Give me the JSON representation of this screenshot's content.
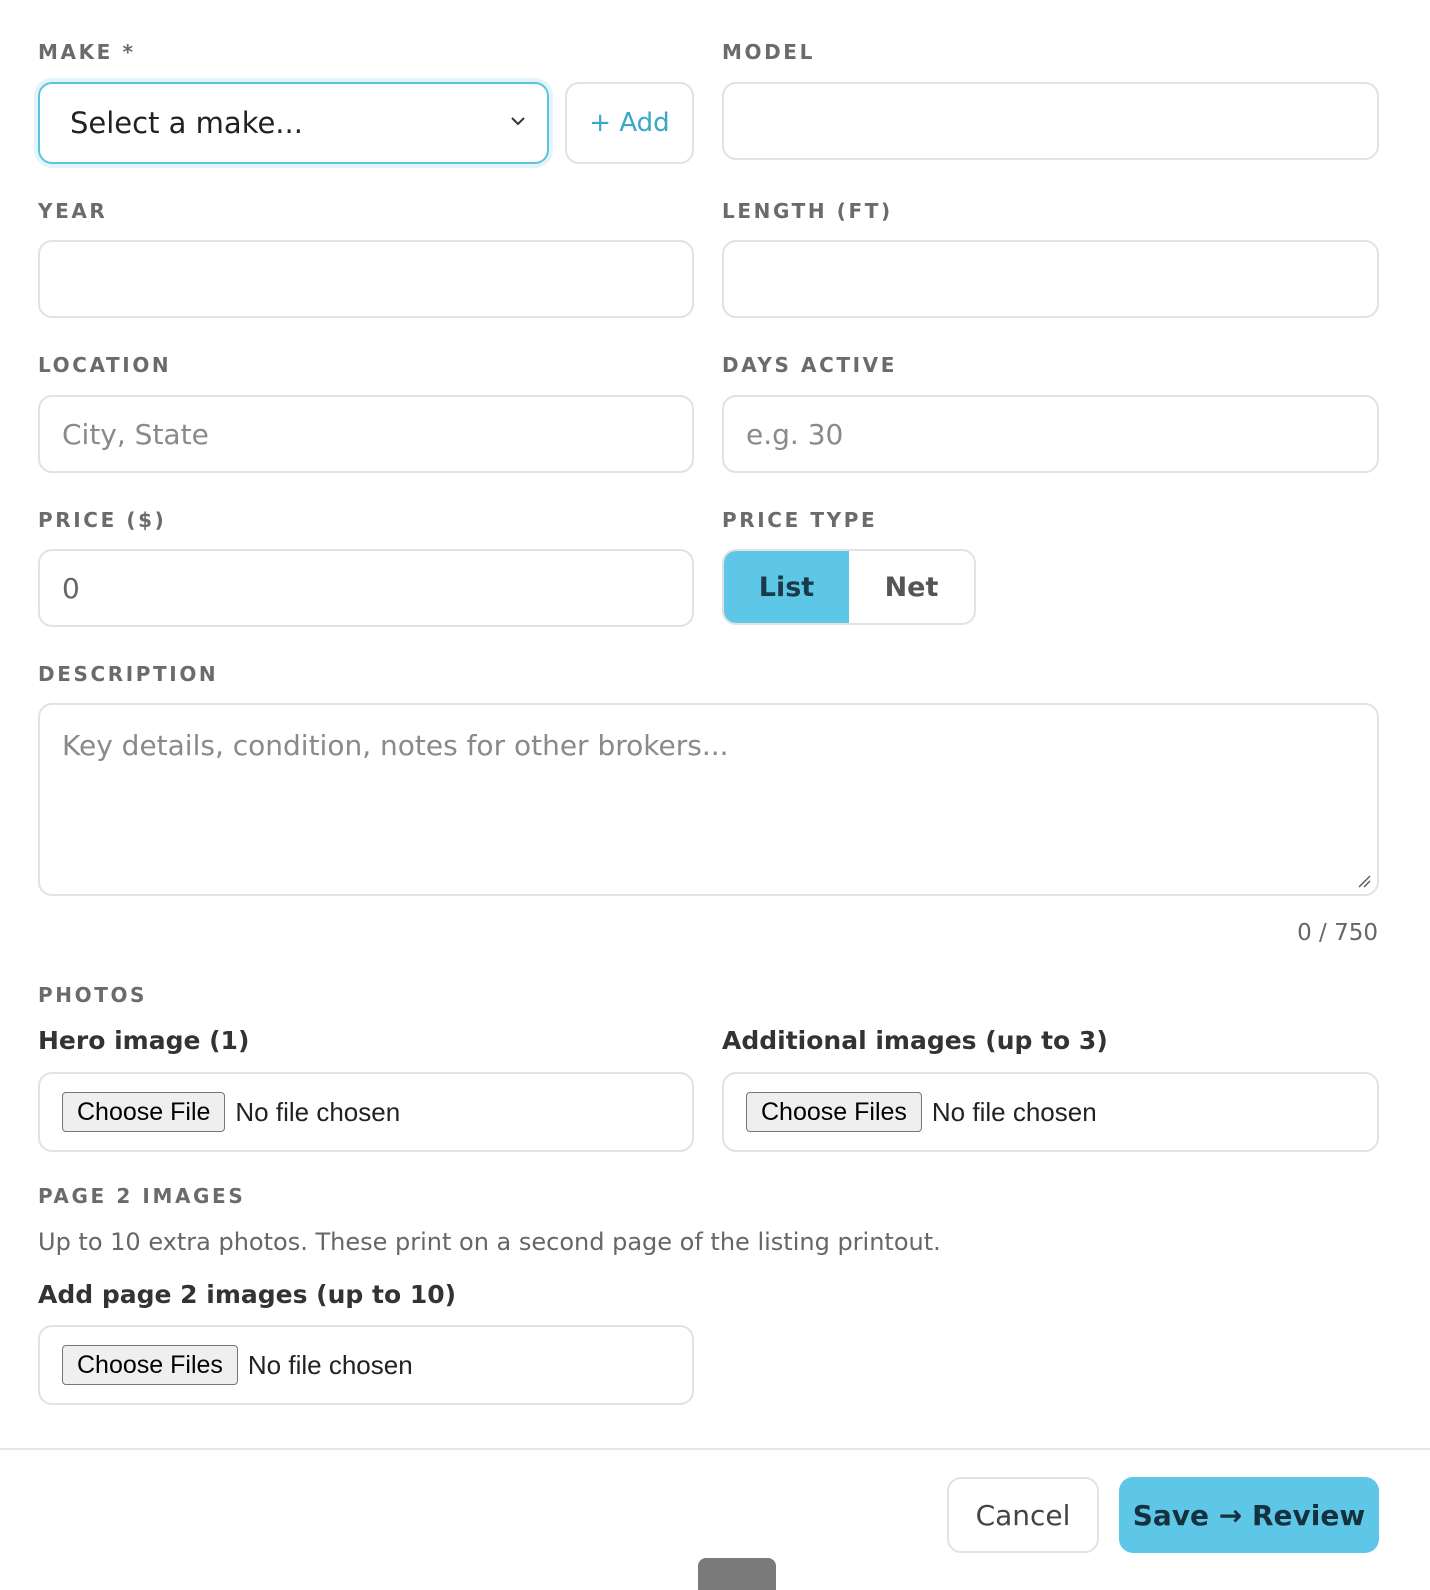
{
  "make": {
    "label": "MAKE *",
    "selected": "Select a make...",
    "add_label": "+ Add"
  },
  "model": {
    "label": "MODEL",
    "value": ""
  },
  "year": {
    "label": "YEAR",
    "value": ""
  },
  "length": {
    "label": "LENGTH (FT)",
    "value": ""
  },
  "location": {
    "label": "LOCATION",
    "placeholder": "City, State"
  },
  "days_active": {
    "label": "DAYS ACTIVE",
    "placeholder": "e.g. 30"
  },
  "price": {
    "label": "PRICE ($)",
    "value": "0"
  },
  "price_type": {
    "label": "PRICE TYPE",
    "options": [
      "List",
      "Net"
    ],
    "selected": "List"
  },
  "description": {
    "label": "DESCRIPTION",
    "placeholder": "Key details, condition, notes for other brokers...",
    "counter": "0 / 750"
  },
  "photos": {
    "label": "PHOTOS",
    "hero": {
      "label": "Hero image (1)",
      "button": "Choose File",
      "status": "No file chosen"
    },
    "additional": {
      "label": "Additional images (up to 3)",
      "button": "Choose Files",
      "status": "No file chosen"
    }
  },
  "page2": {
    "label": "PAGE 2 IMAGES",
    "help": "Up to 10 extra photos. These print on a second page of the listing printout.",
    "sublabel": "Add page 2 images (up to 10)",
    "button": "Choose Files",
    "status": "No file chosen"
  },
  "footer": {
    "cancel": "Cancel",
    "save": "Save → Review"
  },
  "colors": {
    "accent": "#5ec6e6",
    "accent_text": "#3aa7c9",
    "border": "#e2e2e2"
  }
}
